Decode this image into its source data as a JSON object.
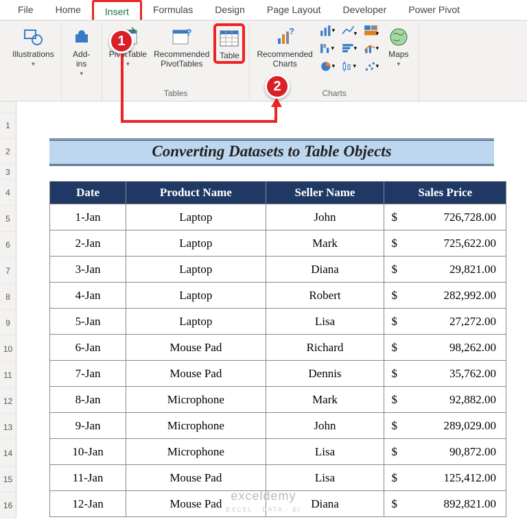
{
  "tabs": {
    "file": "File",
    "home": "Home",
    "insert": "Insert",
    "formulas": "Formulas",
    "design": "Design",
    "page_layout": "Page Layout",
    "developer": "Developer",
    "power_pivot": "Power Pivot"
  },
  "ribbon": {
    "illustrations": "Illustrations",
    "addins": "Add-\nins",
    "pivottable": "PivotTable",
    "rec_pivot": "Recommended\nPivotTables",
    "table": "Table",
    "rec_charts": "Recommended\nCharts",
    "maps": "Maps",
    "group_tables": "Tables",
    "group_charts": "Charts"
  },
  "badges": {
    "one": "1",
    "two": "2"
  },
  "title": "Converting Datasets to Table Objects",
  "row_nums": [
    "1",
    "2",
    "3",
    "4",
    "5",
    "6",
    "7",
    "8",
    "9",
    "10",
    "11",
    "12",
    "13",
    "14",
    "15",
    "16"
  ],
  "headers": {
    "date": "Date",
    "product": "Product Name",
    "seller": "Seller Name",
    "price": "Sales Price"
  },
  "chart_data": {
    "type": "table",
    "columns": [
      "Date",
      "Product Name",
      "Seller Name",
      "Sales Price"
    ],
    "rows": [
      {
        "date": "1-Jan",
        "product": "Laptop",
        "seller": "John",
        "price": "726,728.00"
      },
      {
        "date": "2-Jan",
        "product": "Laptop",
        "seller": "Mark",
        "price": "725,622.00"
      },
      {
        "date": "3-Jan",
        "product": "Laptop",
        "seller": "Diana",
        "price": "29,821.00"
      },
      {
        "date": "4-Jan",
        "product": "Laptop",
        "seller": "Robert",
        "price": "282,992.00"
      },
      {
        "date": "5-Jan",
        "product": "Laptop",
        "seller": "Lisa",
        "price": "27,272.00"
      },
      {
        "date": "6-Jan",
        "product": "Mouse Pad",
        "seller": "Richard",
        "price": "98,262.00"
      },
      {
        "date": "7-Jan",
        "product": "Mouse Pad",
        "seller": "Dennis",
        "price": "35,762.00"
      },
      {
        "date": "8-Jan",
        "product": "Microphone",
        "seller": "Mark",
        "price": "92,882.00"
      },
      {
        "date": "9-Jan",
        "product": "Microphone",
        "seller": "John",
        "price": "289,029.00"
      },
      {
        "date": "10-Jan",
        "product": "Microphone",
        "seller": "Lisa",
        "price": "90,872.00"
      },
      {
        "date": "11-Jan",
        "product": "Mouse Pad",
        "seller": "Lisa",
        "price": "125,412.00"
      },
      {
        "date": "12-Jan",
        "product": "Mouse Pad",
        "seller": "Diana",
        "price": "892,821.00"
      }
    ]
  },
  "currency": "$",
  "watermark": "exceldemy",
  "watermark_sub": "EXCEL · DATA · BI"
}
